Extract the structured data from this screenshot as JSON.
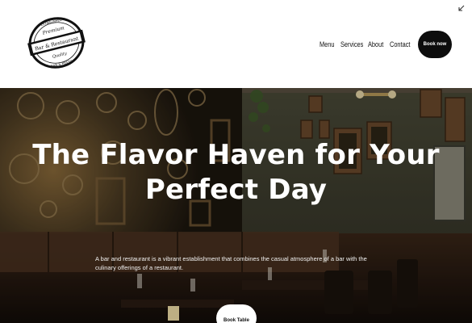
{
  "brand": {
    "logo_lines": [
      "Premium",
      "Bar & Restaurant",
      "Quality"
    ],
    "logo_arc_top": "ESTABLISHED",
    "logo_arc_bottom": "BAR & RESTO"
  },
  "nav": {
    "items": [
      "Menu",
      "Services",
      "About",
      "Contact"
    ],
    "cta": "Book now"
  },
  "hero": {
    "title_line1": "The Flavor Haven for Your",
    "title_line2": "Perfect Day",
    "description": "A bar and restaurant is a vibrant establishment that combines the casual atmosphere of a bar with the culinary offerings of a restaurant.",
    "button": "Book Table"
  },
  "colors": {
    "header_bg": "#ffffff",
    "button_dark": "#0d0d0d",
    "hero_wall": "#3a3a2c"
  },
  "icons": [
    "collapse-arrow-icon"
  ]
}
